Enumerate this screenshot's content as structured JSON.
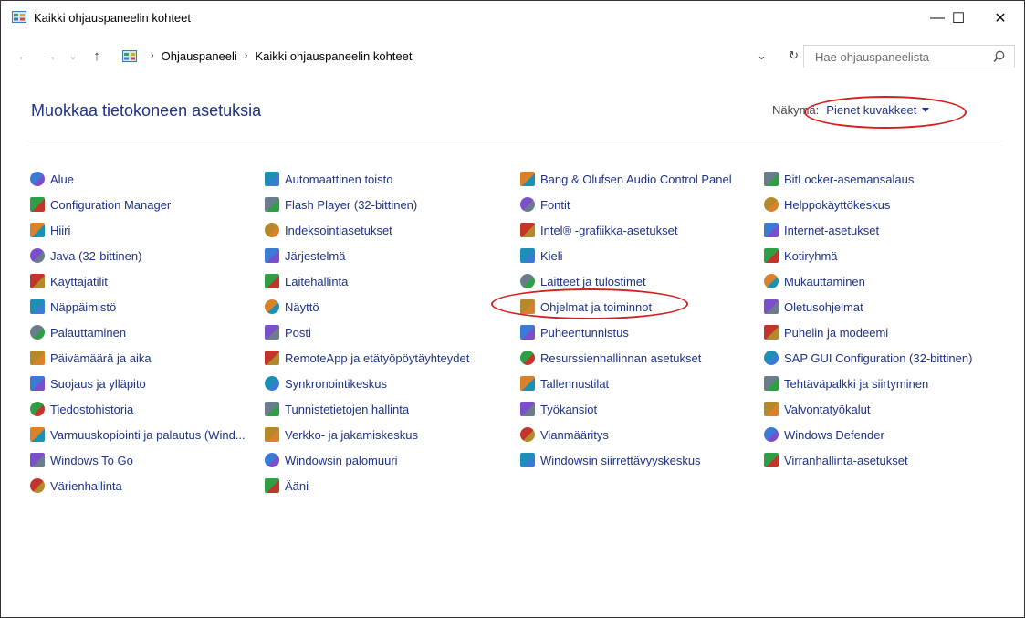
{
  "window": {
    "title": "Kaikki ohjauspaneelin kohteet",
    "minimize": "—",
    "maximize": "☐",
    "close": "✕"
  },
  "nav": {
    "back": "←",
    "forward": "→",
    "recent": "⌄",
    "up": "↑"
  },
  "address": {
    "crumbs": [
      "Ohjauspaneeli",
      "Kaikki ohjauspaneelin kohteet"
    ],
    "separator": "›",
    "dropdown": "⌄",
    "refresh": "↻"
  },
  "search": {
    "placeholder": "Hae ohjauspaneelista"
  },
  "heading": "Muokkaa tietokoneen asetuksia",
  "view": {
    "label": "Näkymä:",
    "value": "Pienet kuvakkeet"
  },
  "items": [
    [
      {
        "label": "Alue",
        "icon": "globe-clock-icon"
      },
      {
        "label": "Configuration Manager",
        "icon": "config-manager-icon"
      },
      {
        "label": "Hiiri",
        "icon": "mouse-icon"
      },
      {
        "label": "Java (32-bittinen)",
        "icon": "java-icon"
      },
      {
        "label": "Käyttäjätilit",
        "icon": "users-icon"
      },
      {
        "label": "Näppäimistö",
        "icon": "keyboard-icon"
      },
      {
        "label": "Palauttaminen",
        "icon": "recovery-icon"
      },
      {
        "label": "Päivämäärä ja aika",
        "icon": "clock-icon"
      },
      {
        "label": "Suojaus ja ylläpito",
        "icon": "flag-icon"
      },
      {
        "label": "Tiedostohistoria",
        "icon": "file-history-icon"
      },
      {
        "label": "Varmuuskopiointi ja palautus (Wind...",
        "icon": "backup-icon"
      },
      {
        "label": "Windows To Go",
        "icon": "usb-drive-icon"
      },
      {
        "label": "Värienhallinta",
        "icon": "color-monitor-icon"
      }
    ],
    [
      {
        "label": "Automaattinen toisto",
        "icon": "autoplay-icon"
      },
      {
        "label": "Flash Player (32-bittinen)",
        "icon": "flash-icon"
      },
      {
        "label": "Indeksointiasetukset",
        "icon": "indexing-icon"
      },
      {
        "label": "Järjestelmä",
        "icon": "system-icon"
      },
      {
        "label": "Laitehallinta",
        "icon": "device-manager-icon"
      },
      {
        "label": "Näyttö",
        "icon": "display-icon"
      },
      {
        "label": "Posti",
        "icon": "mail-icon"
      },
      {
        "label": "RemoteApp ja etätyöpöytäyhteydet",
        "icon": "remoteapp-icon"
      },
      {
        "label": "Synkronointikeskus",
        "icon": "sync-icon"
      },
      {
        "label": "Tunnistetietojen hallinta",
        "icon": "credential-icon"
      },
      {
        "label": "Verkko- ja jakamiskeskus",
        "icon": "network-icon"
      },
      {
        "label": "Windowsin palomuuri",
        "icon": "firewall-icon"
      },
      {
        "label": "Ääni",
        "icon": "speaker-icon"
      }
    ],
    [
      {
        "label": "Bang & Olufsen Audio Control Panel",
        "icon": "bo-icon"
      },
      {
        "label": "Fontit",
        "icon": "font-icon"
      },
      {
        "label": "Intel® -grafiikka-asetukset",
        "icon": "intel-graphics-icon"
      },
      {
        "label": "Kieli",
        "icon": "language-icon"
      },
      {
        "label": "Laitteet ja tulostimet",
        "icon": "printer-icon"
      },
      {
        "label": "Ohjelmat ja toiminnot",
        "icon": "programs-icon"
      },
      {
        "label": "Puheentunnistus",
        "icon": "microphone-icon"
      },
      {
        "label": "Resurssienhallinnan asetukset",
        "icon": "explorer-options-icon"
      },
      {
        "label": "Tallennustilat",
        "icon": "storage-icon"
      },
      {
        "label": "Työkansiot",
        "icon": "work-folders-icon"
      },
      {
        "label": "Vianmääritys",
        "icon": "troubleshoot-icon"
      },
      {
        "label": "Windowsin siirrettävyyskeskus",
        "icon": "mobility-icon"
      }
    ],
    [
      {
        "label": "BitLocker-asemansalaus",
        "icon": "bitlocker-icon"
      },
      {
        "label": "Helppokäyttökeskus",
        "icon": "accessibility-icon"
      },
      {
        "label": "Internet-asetukset",
        "icon": "internet-options-icon"
      },
      {
        "label": "Kotiryhmä",
        "icon": "homegroup-icon"
      },
      {
        "label": "Mukauttaminen",
        "icon": "personalization-icon"
      },
      {
        "label": "Oletusohjelmat",
        "icon": "default-programs-icon"
      },
      {
        "label": "Puhelin ja modeemi",
        "icon": "phone-modem-icon"
      },
      {
        "label": "SAP GUI Configuration (32-bittinen)",
        "icon": "sap-icon"
      },
      {
        "label": "Tehtäväpalkki ja siirtyminen",
        "icon": "taskbar-icon"
      },
      {
        "label": "Valvontatyökalut",
        "icon": "admin-tools-icon"
      },
      {
        "label": "Windows Defender",
        "icon": "defender-icon"
      },
      {
        "label": "Virranhallinta-asetukset",
        "icon": "power-icon"
      }
    ]
  ],
  "colors": {
    "link": "#1e3287",
    "annotation": "#d42020"
  }
}
